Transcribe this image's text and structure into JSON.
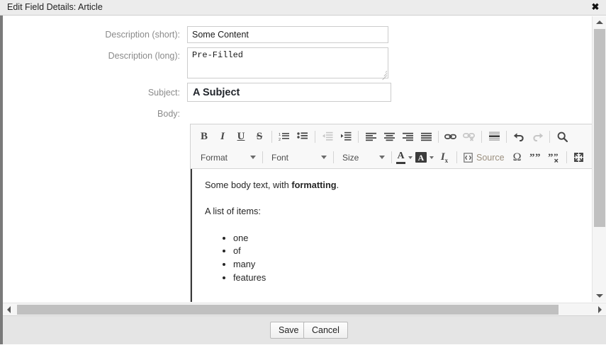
{
  "window": {
    "title": "Edit Field Details: Article",
    "close_icon": "close-icon"
  },
  "form": {
    "fields": [
      {
        "label": "Description (short):",
        "value": "Some Content",
        "type": "text"
      },
      {
        "label": "Description (long):",
        "value": "Pre-Filled",
        "type": "textarea"
      },
      {
        "label": "Subject:",
        "value": "A Subject",
        "type": "text"
      },
      {
        "label": "Body:",
        "value": "",
        "type": "richtext"
      }
    ]
  },
  "editor": {
    "toolbar_row1": [
      {
        "name": "bold-icon",
        "label": "B",
        "enabled": true
      },
      {
        "name": "italic-icon",
        "label": "I",
        "enabled": true
      },
      {
        "name": "underline-icon",
        "label": "U",
        "enabled": true
      },
      {
        "name": "strikethrough-icon",
        "label": "S",
        "enabled": true
      },
      {
        "name": "numbered-list-icon",
        "label": "",
        "enabled": true
      },
      {
        "name": "bulleted-list-icon",
        "label": "",
        "enabled": true
      },
      {
        "name": "decrease-indent-icon",
        "label": "",
        "enabled": false
      },
      {
        "name": "increase-indent-icon",
        "label": "",
        "enabled": true
      },
      {
        "name": "align-left-icon",
        "label": "",
        "enabled": true
      },
      {
        "name": "align-center-icon",
        "label": "",
        "enabled": true
      },
      {
        "name": "align-right-icon",
        "label": "",
        "enabled": true
      },
      {
        "name": "align-justify-icon",
        "label": "",
        "enabled": true
      },
      {
        "name": "link-icon",
        "label": "",
        "enabled": true
      },
      {
        "name": "unlink-icon",
        "label": "",
        "enabled": false
      },
      {
        "name": "horizontal-rule-icon",
        "label": "",
        "enabled": true
      },
      {
        "name": "undo-icon",
        "label": "",
        "enabled": true
      },
      {
        "name": "redo-icon",
        "label": "",
        "enabled": false
      },
      {
        "name": "find-icon",
        "label": "",
        "enabled": true
      }
    ],
    "dropdowns": [
      {
        "name": "format-dropdown",
        "label": "Format"
      },
      {
        "name": "font-dropdown",
        "label": "Font"
      },
      {
        "name": "size-dropdown",
        "label": "Size"
      }
    ],
    "toolbar_row2": [
      {
        "name": "text-color-icon",
        "label": "A",
        "enabled": true
      },
      {
        "name": "background-color-icon",
        "label": "A",
        "enabled": true
      },
      {
        "name": "remove-format-icon",
        "label": "I",
        "sub": "x",
        "enabled": true
      },
      {
        "name": "source-button",
        "label": "Source",
        "enabled": true
      },
      {
        "name": "special-character-icon",
        "label": "Ω",
        "enabled": true
      },
      {
        "name": "insert-quote-icon",
        "label": "",
        "enabled": true
      },
      {
        "name": "remove-quote-icon",
        "label": "",
        "enabled": true
      },
      {
        "name": "maximize-icon",
        "label": "",
        "enabled": true
      }
    ],
    "body": {
      "paragraph1_pre": "Some body text, with ",
      "paragraph1_bold": "formatting",
      "paragraph1_post": ".",
      "paragraph2": "A list of items:",
      "list_items": [
        "one",
        "of",
        "many",
        "features"
      ]
    }
  },
  "footer": {
    "save_label": "Save",
    "cancel_label": "Cancel"
  },
  "colors": {
    "titlebar_bg": "#ececec",
    "label_gray": "#8a8a8a",
    "source_text": "#9b8f7e",
    "footer_bg": "#e5e5e5",
    "scrollbar_thumb": "#c0c0c0"
  }
}
